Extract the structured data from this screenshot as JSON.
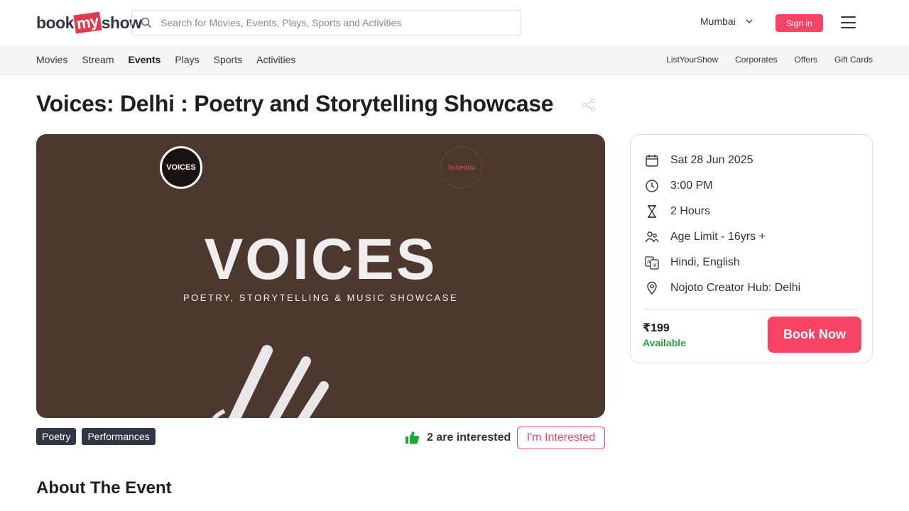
{
  "header": {
    "logo": {
      "part1": "book",
      "part2": "my",
      "part3": "show"
    },
    "search_placeholder": "Search for Movies, Events, Plays, Sports and Activities",
    "city": "Mumbai",
    "signin_label": "Sign in"
  },
  "nav": {
    "left": [
      "Movies",
      "Stream",
      "Events",
      "Plays",
      "Sports",
      "Activities"
    ],
    "active": "Events",
    "right": [
      "ListYourShow",
      "Corporates",
      "Offers",
      "Gift Cards"
    ]
  },
  "event": {
    "title": "Voices: Delhi : Poetry and Storytelling Showcase",
    "banner": {
      "badge_left": "VOICES",
      "badge_right": "bohemia",
      "heading": "VOICES",
      "subheading": "POETRY, STORYTELLING & MUSIC SHOWCASE",
      "background": "#4d3830"
    },
    "details": {
      "date": "Sat 28 Jun 2025",
      "time": "3:00 PM",
      "duration": "2 Hours",
      "age_limit": "Age Limit - 16yrs +",
      "languages": "Hindi, English",
      "venue": "Nojoto Creator Hub: Delhi"
    },
    "price": "₹199",
    "availability": "Available",
    "book_label": "Book Now",
    "tags": [
      "Poetry",
      "Performances"
    ],
    "interested_count": "2 are interested",
    "interested_button": "I'm Interested"
  },
  "sections": {
    "about_heading": "About The Event"
  },
  "colors": {
    "accent": "#f84464",
    "available": "#1ea83c",
    "tag_bg": "#333545"
  }
}
